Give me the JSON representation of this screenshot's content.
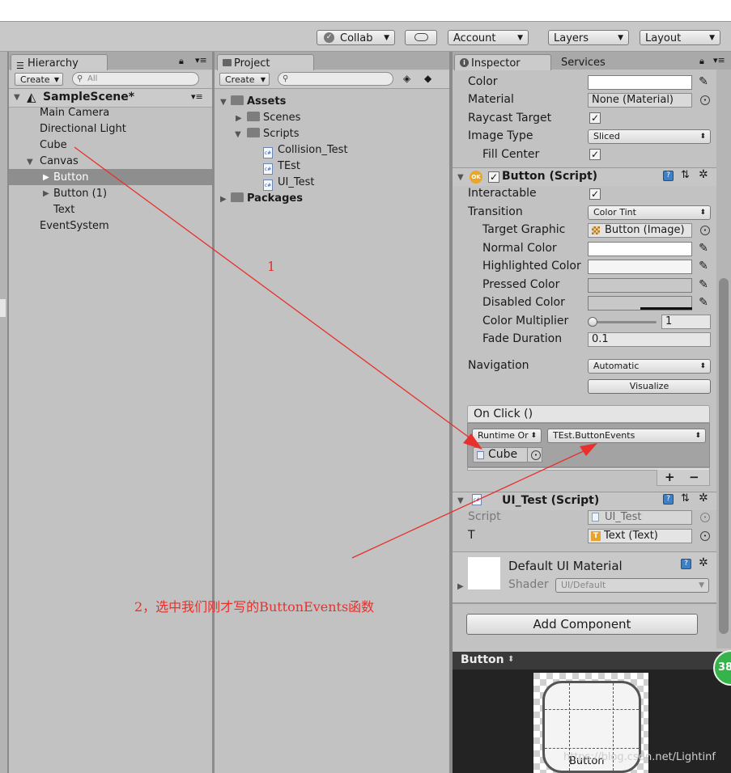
{
  "toolbar": {
    "collab": "Collab",
    "account": "Account",
    "layers": "Layers",
    "layout": "Layout"
  },
  "hierarchy": {
    "tab": "Hierarchy",
    "create": "Create",
    "search_placeholder": "All",
    "scene": "SampleScene*",
    "items": [
      "Main Camera",
      "Directional Light",
      "Cube",
      "Canvas",
      "Button",
      "Button (1)",
      "Text",
      "EventSystem"
    ]
  },
  "project": {
    "tab": "Project",
    "create": "Create",
    "items": [
      "Assets",
      "Scenes",
      "Scripts",
      "Collision_Test",
      "TEst",
      "UI_Test",
      "Packages"
    ]
  },
  "inspector": {
    "tab": "Inspector",
    "tab2": "Services",
    "image": {
      "color_label": "Color",
      "material_label": "Material",
      "material_value": "None (Material)",
      "raycast_label": "Raycast Target",
      "image_type_label": "Image Type",
      "image_type_value": "Sliced",
      "fill_center_label": "Fill Center"
    },
    "button": {
      "title": "Button (Script)",
      "interactable_label": "Interactable",
      "transition_label": "Transition",
      "transition_value": "Color Tint",
      "target_graphic_label": "Target Graphic",
      "target_graphic_value": "Button (Image)",
      "normal_color_label": "Normal Color",
      "highlighted_color_label": "Highlighted Color",
      "pressed_color_label": "Pressed Color",
      "disabled_color_label": "Disabled Color",
      "color_multiplier_label": "Color Multiplier",
      "color_multiplier_value": "1",
      "fade_duration_label": "Fade Duration",
      "fade_duration_value": "0.1",
      "navigation_label": "Navigation",
      "navigation_value": "Automatic",
      "visualize": "Visualize",
      "onclick_header": "On Click ()",
      "runtime_value": "Runtime Or",
      "function_value": "TEst.ButtonEvents",
      "object_value": "Cube",
      "plus": "+",
      "minus": "−"
    },
    "ui_test": {
      "title": "UI_Test (Script)",
      "script_label": "Script",
      "script_value": "UI_Test",
      "t_label": "T",
      "t_value": "Text (Text)"
    },
    "material": {
      "title": "Default UI Material",
      "shader_label": "Shader",
      "shader_value": "UI/Default"
    },
    "add_component": "Add Component",
    "preview_title": "Button",
    "preview_caption": "Button",
    "badge": "38"
  },
  "annotations": {
    "note1": "1",
    "note2": "2，选中我们刚才写的ButtonEvents函数"
  },
  "watermark": "https://blog.csdn.net/Lightinf",
  "colors": {
    "annotation": "#e8302c",
    "accent_blue": "#3f7fc4"
  }
}
